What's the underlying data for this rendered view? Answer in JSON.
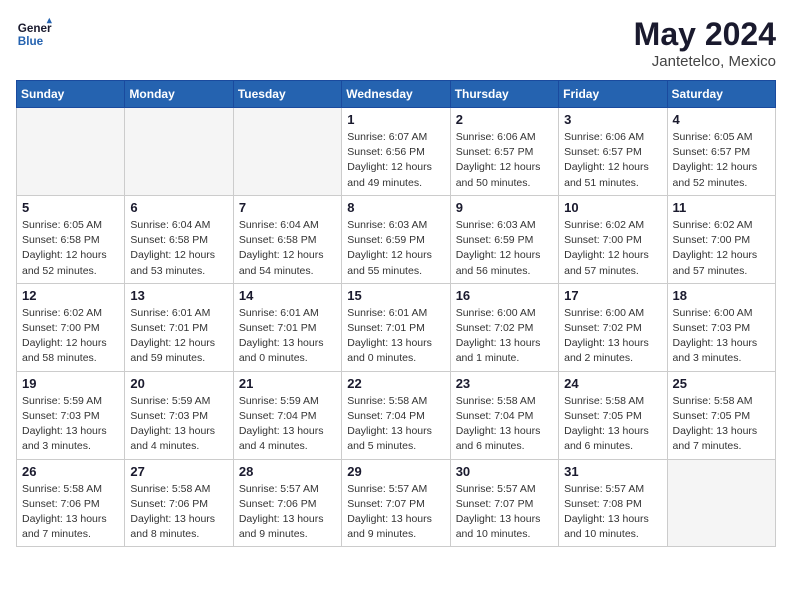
{
  "logo": {
    "line1": "General",
    "line2": "Blue"
  },
  "title": "May 2024",
  "location": "Jantetelco, Mexico",
  "weekdays": [
    "Sunday",
    "Monday",
    "Tuesday",
    "Wednesday",
    "Thursday",
    "Friday",
    "Saturday"
  ],
  "weeks": [
    [
      {
        "day": "",
        "info": ""
      },
      {
        "day": "",
        "info": ""
      },
      {
        "day": "",
        "info": ""
      },
      {
        "day": "1",
        "info": "Sunrise: 6:07 AM\nSunset: 6:56 PM\nDaylight: 12 hours\nand 49 minutes."
      },
      {
        "day": "2",
        "info": "Sunrise: 6:06 AM\nSunset: 6:57 PM\nDaylight: 12 hours\nand 50 minutes."
      },
      {
        "day": "3",
        "info": "Sunrise: 6:06 AM\nSunset: 6:57 PM\nDaylight: 12 hours\nand 51 minutes."
      },
      {
        "day": "4",
        "info": "Sunrise: 6:05 AM\nSunset: 6:57 PM\nDaylight: 12 hours\nand 52 minutes."
      }
    ],
    [
      {
        "day": "5",
        "info": "Sunrise: 6:05 AM\nSunset: 6:58 PM\nDaylight: 12 hours\nand 52 minutes."
      },
      {
        "day": "6",
        "info": "Sunrise: 6:04 AM\nSunset: 6:58 PM\nDaylight: 12 hours\nand 53 minutes."
      },
      {
        "day": "7",
        "info": "Sunrise: 6:04 AM\nSunset: 6:58 PM\nDaylight: 12 hours\nand 54 minutes."
      },
      {
        "day": "8",
        "info": "Sunrise: 6:03 AM\nSunset: 6:59 PM\nDaylight: 12 hours\nand 55 minutes."
      },
      {
        "day": "9",
        "info": "Sunrise: 6:03 AM\nSunset: 6:59 PM\nDaylight: 12 hours\nand 56 minutes."
      },
      {
        "day": "10",
        "info": "Sunrise: 6:02 AM\nSunset: 7:00 PM\nDaylight: 12 hours\nand 57 minutes."
      },
      {
        "day": "11",
        "info": "Sunrise: 6:02 AM\nSunset: 7:00 PM\nDaylight: 12 hours\nand 57 minutes."
      }
    ],
    [
      {
        "day": "12",
        "info": "Sunrise: 6:02 AM\nSunset: 7:00 PM\nDaylight: 12 hours\nand 58 minutes."
      },
      {
        "day": "13",
        "info": "Sunrise: 6:01 AM\nSunset: 7:01 PM\nDaylight: 12 hours\nand 59 minutes."
      },
      {
        "day": "14",
        "info": "Sunrise: 6:01 AM\nSunset: 7:01 PM\nDaylight: 13 hours\nand 0 minutes."
      },
      {
        "day": "15",
        "info": "Sunrise: 6:01 AM\nSunset: 7:01 PM\nDaylight: 13 hours\nand 0 minutes."
      },
      {
        "day": "16",
        "info": "Sunrise: 6:00 AM\nSunset: 7:02 PM\nDaylight: 13 hours\nand 1 minute."
      },
      {
        "day": "17",
        "info": "Sunrise: 6:00 AM\nSunset: 7:02 PM\nDaylight: 13 hours\nand 2 minutes."
      },
      {
        "day": "18",
        "info": "Sunrise: 6:00 AM\nSunset: 7:03 PM\nDaylight: 13 hours\nand 3 minutes."
      }
    ],
    [
      {
        "day": "19",
        "info": "Sunrise: 5:59 AM\nSunset: 7:03 PM\nDaylight: 13 hours\nand 3 minutes."
      },
      {
        "day": "20",
        "info": "Sunrise: 5:59 AM\nSunset: 7:03 PM\nDaylight: 13 hours\nand 4 minutes."
      },
      {
        "day": "21",
        "info": "Sunrise: 5:59 AM\nSunset: 7:04 PM\nDaylight: 13 hours\nand 4 minutes."
      },
      {
        "day": "22",
        "info": "Sunrise: 5:58 AM\nSunset: 7:04 PM\nDaylight: 13 hours\nand 5 minutes."
      },
      {
        "day": "23",
        "info": "Sunrise: 5:58 AM\nSunset: 7:04 PM\nDaylight: 13 hours\nand 6 minutes."
      },
      {
        "day": "24",
        "info": "Sunrise: 5:58 AM\nSunset: 7:05 PM\nDaylight: 13 hours\nand 6 minutes."
      },
      {
        "day": "25",
        "info": "Sunrise: 5:58 AM\nSunset: 7:05 PM\nDaylight: 13 hours\nand 7 minutes."
      }
    ],
    [
      {
        "day": "26",
        "info": "Sunrise: 5:58 AM\nSunset: 7:06 PM\nDaylight: 13 hours\nand 7 minutes."
      },
      {
        "day": "27",
        "info": "Sunrise: 5:58 AM\nSunset: 7:06 PM\nDaylight: 13 hours\nand 8 minutes."
      },
      {
        "day": "28",
        "info": "Sunrise: 5:57 AM\nSunset: 7:06 PM\nDaylight: 13 hours\nand 9 minutes."
      },
      {
        "day": "29",
        "info": "Sunrise: 5:57 AM\nSunset: 7:07 PM\nDaylight: 13 hours\nand 9 minutes."
      },
      {
        "day": "30",
        "info": "Sunrise: 5:57 AM\nSunset: 7:07 PM\nDaylight: 13 hours\nand 10 minutes."
      },
      {
        "day": "31",
        "info": "Sunrise: 5:57 AM\nSunset: 7:08 PM\nDaylight: 13 hours\nand 10 minutes."
      },
      {
        "day": "",
        "info": ""
      }
    ]
  ]
}
